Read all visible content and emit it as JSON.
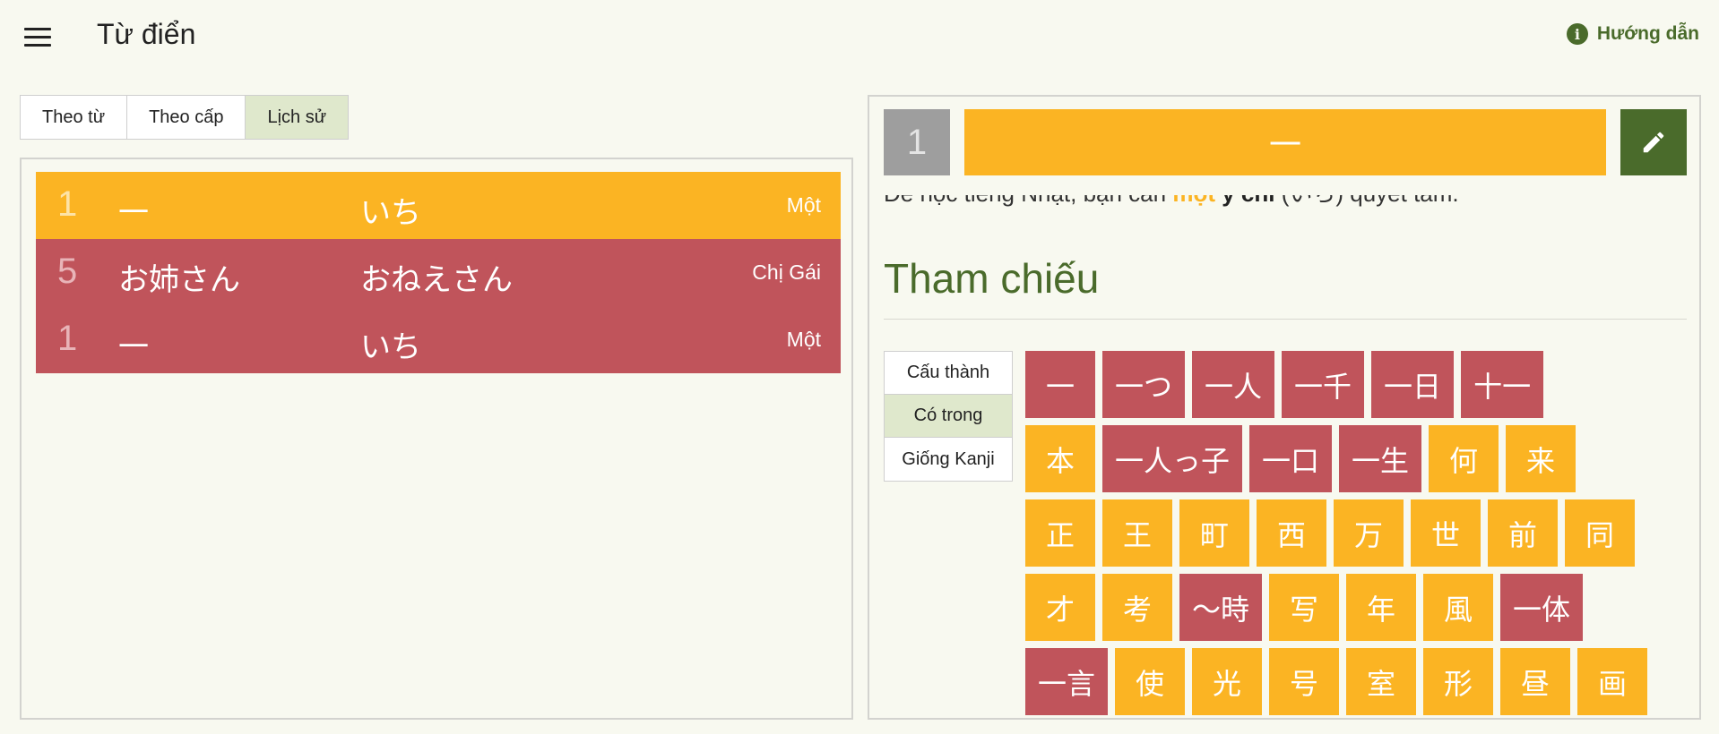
{
  "header": {
    "title": "Từ điển",
    "help_label": "Hướng dẫn",
    "help_icon_glyph": "i"
  },
  "tabs": [
    {
      "label": "Theo từ",
      "active": false
    },
    {
      "label": "Theo cấp",
      "active": false
    },
    {
      "label": "Lịch sử",
      "active": true
    }
  ],
  "history": [
    {
      "level": "1",
      "word": "一",
      "reading": "いち",
      "meaning": "Một",
      "color": "yellow"
    },
    {
      "level": "5",
      "word": "お姉さん",
      "reading": "おねえさん",
      "meaning": "Chị Gái",
      "color": "red"
    },
    {
      "level": "1",
      "word": "一",
      "reading": "いち",
      "meaning": "Một",
      "color": "red"
    }
  ],
  "detail": {
    "level": "1",
    "kanji": "一",
    "edit_icon": "pencil-icon",
    "example": {
      "before": "Để học tiếng Nhật, bạn cần ",
      "highlight": "một",
      "bold": " ý chí",
      "after": " (いち) quyết tâm."
    },
    "section_title": "Tham chiếu",
    "ref_tabs": [
      {
        "label": "Cấu thành",
        "active": false
      },
      {
        "label": "Có trong",
        "active": true
      },
      {
        "label": "Giống Kanji",
        "active": false
      }
    ],
    "chip_rows": [
      [
        {
          "text": "一",
          "color": "red"
        },
        {
          "text": "一つ",
          "color": "red"
        },
        {
          "text": "一人",
          "color": "red"
        },
        {
          "text": "一千",
          "color": "red"
        },
        {
          "text": "一日",
          "color": "red"
        },
        {
          "text": "十一",
          "color": "red"
        }
      ],
      [
        {
          "text": "本",
          "color": "yellow"
        },
        {
          "text": "一人っ子",
          "color": "red"
        },
        {
          "text": "一口",
          "color": "red"
        },
        {
          "text": "一生",
          "color": "red"
        },
        {
          "text": "何",
          "color": "yellow"
        },
        {
          "text": "来",
          "color": "yellow"
        }
      ],
      [
        {
          "text": "正",
          "color": "yellow"
        },
        {
          "text": "王",
          "color": "yellow"
        },
        {
          "text": "町",
          "color": "yellow"
        },
        {
          "text": "西",
          "color": "yellow"
        },
        {
          "text": "万",
          "color": "yellow"
        },
        {
          "text": "世",
          "color": "yellow"
        },
        {
          "text": "前",
          "color": "yellow"
        },
        {
          "text": "同",
          "color": "yellow"
        }
      ],
      [
        {
          "text": "才",
          "color": "yellow"
        },
        {
          "text": "考",
          "color": "yellow"
        },
        {
          "text": "〜時",
          "color": "red"
        },
        {
          "text": "写",
          "color": "yellow"
        },
        {
          "text": "年",
          "color": "yellow"
        },
        {
          "text": "風",
          "color": "yellow"
        },
        {
          "text": "一体",
          "color": "red"
        }
      ],
      [
        {
          "text": "一言",
          "color": "red"
        },
        {
          "text": "使",
          "color": "yellow"
        },
        {
          "text": "光",
          "color": "yellow"
        },
        {
          "text": "号",
          "color": "yellow"
        },
        {
          "text": "室",
          "color": "yellow"
        },
        {
          "text": "形",
          "color": "yellow"
        },
        {
          "text": "昼",
          "color": "yellow"
        },
        {
          "text": "画",
          "color": "yellow"
        }
      ]
    ]
  },
  "colors": {
    "accent_yellow": "#fbb423",
    "accent_red": "#c0545b",
    "brand_green": "#4a6b2b",
    "active_tab": "#dfe8cc"
  }
}
